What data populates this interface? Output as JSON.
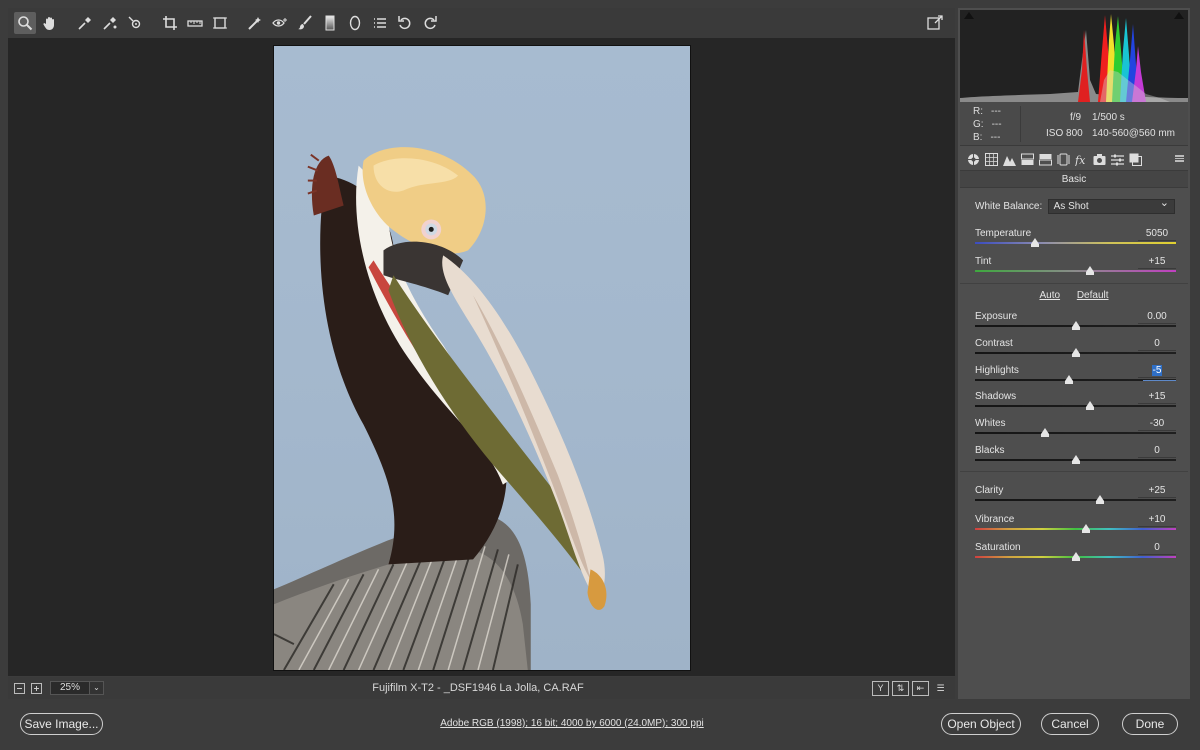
{
  "toolbar": {
    "tools": [
      "zoom-icon",
      "hand-icon",
      "white-balance-icon",
      "color-sampler-icon",
      "target-adjust-icon",
      "crop-icon",
      "straighten-icon",
      "transform-icon",
      "spot-removal-icon",
      "red-eye-icon",
      "adjustment-brush-icon",
      "graduated-filter-icon",
      "radial-filter-icon",
      "presets-list-icon",
      "rotate-ccw-icon",
      "rotate-cw-icon"
    ],
    "fullscreen_icon": "toggle-fullscreen-icon"
  },
  "histogram": {
    "rgb": {
      "r_label": "R:",
      "g_label": "G:",
      "b_label": "B:",
      "r": "---",
      "g": "---",
      "b": "---"
    },
    "exif": {
      "aperture": "f/9",
      "shutter": "1/500 s",
      "iso": "ISO 800",
      "lens": "140-560@560 mm"
    }
  },
  "panel": {
    "tabs": [
      "basic-tab-icon",
      "tone-curve-tab-icon",
      "detail-tab-icon",
      "hsl-tab-icon",
      "split-toning-tab-icon",
      "lens-corrections-tab-icon",
      "effects-tab-icon",
      "camera-calibration-tab-icon",
      "presets-tab-icon",
      "snapshots-tab-icon"
    ],
    "title": "Basic",
    "white_balance": {
      "label": "White Balance:",
      "value": "As Shot"
    },
    "auto_label": "Auto",
    "default_label": "Default",
    "sliders": [
      {
        "label": "Temperature",
        "value": "5050",
        "pos": 0.3,
        "track": "temp"
      },
      {
        "label": "Tint",
        "value": "+15",
        "pos": 0.57,
        "track": "tint"
      },
      {
        "label": "Exposure",
        "value": "0.00",
        "pos": 0.5,
        "track": "dark"
      },
      {
        "label": "Contrast",
        "value": "0",
        "pos": 0.5,
        "track": "dark"
      },
      {
        "label": "Highlights",
        "value": "-5",
        "pos": 0.47,
        "track": "dark",
        "selected": true
      },
      {
        "label": "Shadows",
        "value": "+15",
        "pos": 0.57,
        "track": "dark"
      },
      {
        "label": "Whites",
        "value": "-30",
        "pos": 0.35,
        "track": "dark"
      },
      {
        "label": "Blacks",
        "value": "0",
        "pos": 0.5,
        "track": "dark"
      },
      {
        "label": "Clarity",
        "value": "+25",
        "pos": 0.62,
        "track": "dark"
      },
      {
        "label": "Vibrance",
        "value": "+10",
        "pos": 0.55,
        "track": "spectrum"
      },
      {
        "label": "Saturation",
        "value": "0",
        "pos": 0.5,
        "track": "spectrum"
      }
    ]
  },
  "statusbar": {
    "zoom": "25%",
    "filename": "Fujifilm X-T2  -  _DSF1946 La Jolla, CA.RAF",
    "y_label": "Y"
  },
  "bottom": {
    "save_label": "Save Image...",
    "workflow": "Adobe RGB (1998); 16 bit; 4000 by 6000 (24.0MP); 300 ppi",
    "open_label": "Open Object",
    "cancel_label": "Cancel",
    "done_label": "Done"
  },
  "colors": {
    "accent": "#2f6fc6",
    "panel": "#4e4e4e",
    "canvas": "#262626"
  }
}
